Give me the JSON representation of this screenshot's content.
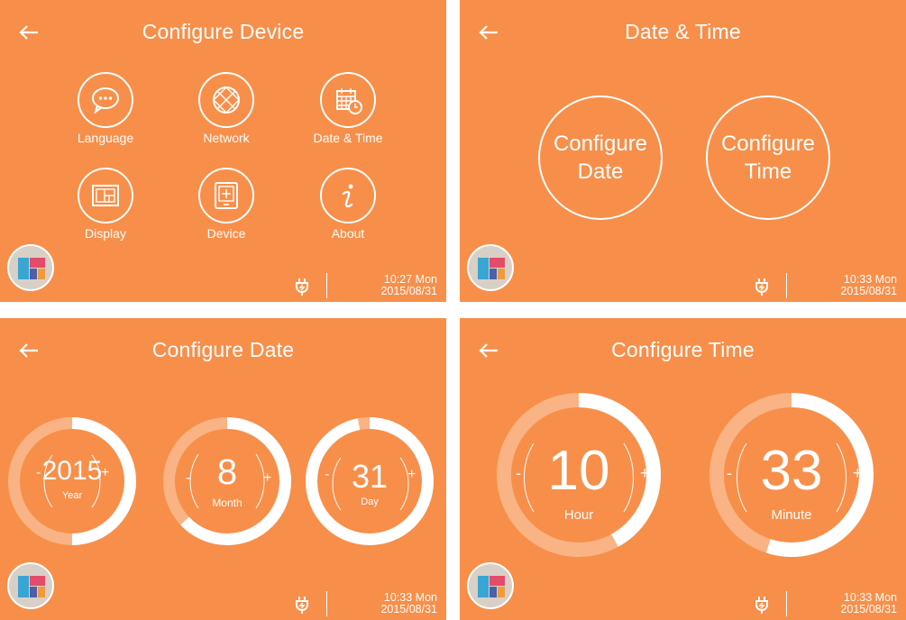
{
  "colors": {
    "background": "#F78F4A",
    "ring_track": "#F9B384",
    "ring_fill": "#FFFFFF",
    "badge": "#D8D0C7"
  },
  "screens": {
    "configure_device": {
      "title": "Configure Device",
      "tiles": [
        {
          "label": "Language",
          "icon": "chat-bubble-icon"
        },
        {
          "label": "Network",
          "icon": "globe-icon"
        },
        {
          "label": "Date & Time",
          "icon": "calendar-clock-icon"
        },
        {
          "label": "Display",
          "icon": "display-layout-icon"
        },
        {
          "label": "Device",
          "icon": "tablet-plus-icon"
        },
        {
          "label": "About",
          "icon": "info-icon"
        }
      ],
      "status": {
        "time": "10:27 Mon",
        "date": "2015/08/31"
      }
    },
    "date_time": {
      "title": "Date & Time",
      "buttons": [
        {
          "line1": "Configure",
          "line2": "Date"
        },
        {
          "line1": "Configure",
          "line2": "Time"
        }
      ],
      "status": {
        "time": "10:33 Mon",
        "date": "2015/08/31"
      }
    },
    "configure_date": {
      "title": "Configure Date",
      "dials": [
        {
          "value": "2015",
          "unit": "Year",
          "minus": "-",
          "plus": "+",
          "progress": 0.5
        },
        {
          "value": "8",
          "unit": "Month",
          "minus": "-",
          "plus": "+",
          "progress": 0.63
        },
        {
          "value": "31",
          "unit": "Day",
          "minus": "-",
          "plus": "+",
          "progress": 0.97
        }
      ],
      "status": {
        "time": "10:33 Mon",
        "date": "2015/08/31"
      }
    },
    "configure_time": {
      "title": "Configure Time",
      "dials": [
        {
          "value": "10",
          "unit": "Hour",
          "minus": "-",
          "plus": "+",
          "progress": 0.42
        },
        {
          "value": "33",
          "unit": "Minute",
          "minus": "-",
          "plus": "+",
          "progress": 0.55
        }
      ],
      "status": {
        "time": "10:33 Mon",
        "date": "2015/08/31"
      }
    }
  }
}
